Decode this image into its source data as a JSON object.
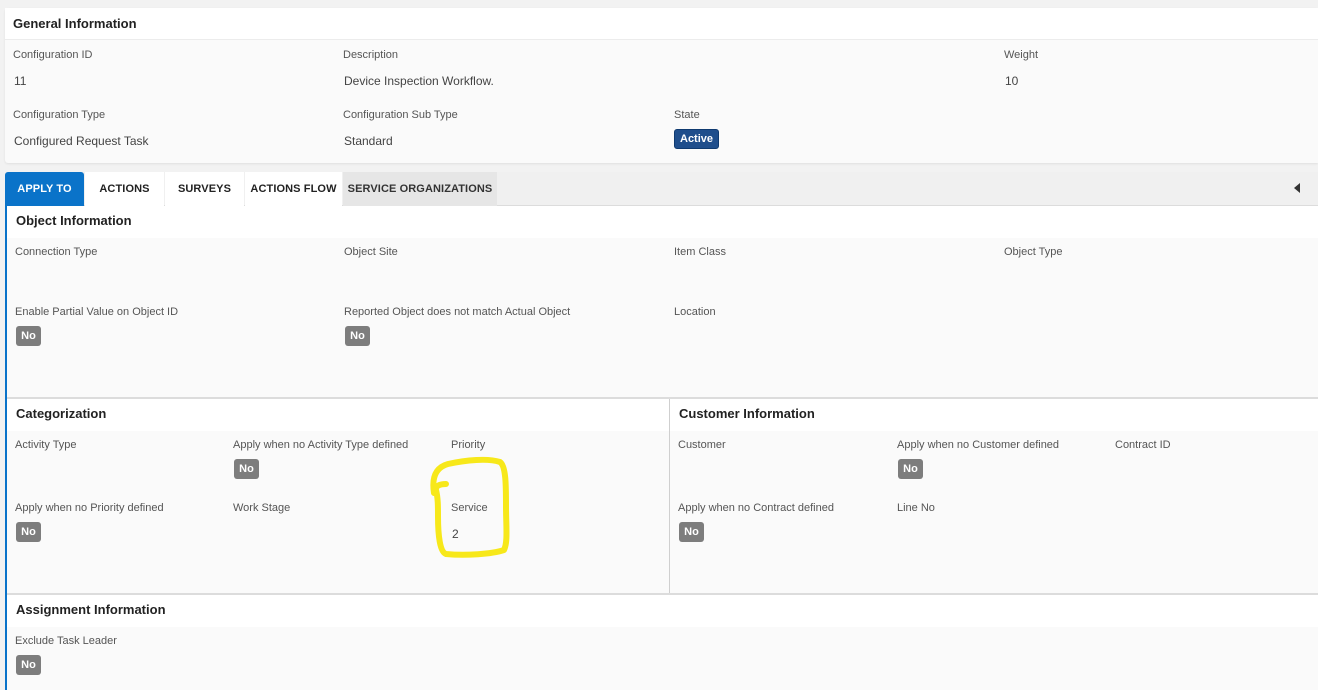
{
  "general": {
    "title": "General Information",
    "config_id_label": "Configuration ID",
    "config_id_value": "11",
    "description_label": "Description",
    "description_value": "Device Inspection Workflow.",
    "weight_label": "Weight",
    "weight_value": "10",
    "config_type_label": "Configuration Type",
    "config_type_value": "Configured Request Task",
    "config_subtype_label": "Configuration Sub Type",
    "config_subtype_value": "Standard",
    "state_label": "State",
    "state_value": "Active"
  },
  "tabs": [
    "APPLY TO",
    "ACTIONS",
    "SURVEYS",
    "ACTIONS FLOW",
    "SERVICE ORGANIZATIONS"
  ],
  "object_info": {
    "title": "Object Information",
    "connection_type_label": "Connection Type",
    "object_site_label": "Object Site",
    "item_class_label": "Item Class",
    "object_type_label": "Object Type",
    "enable_partial_label": "Enable Partial Value on Object ID",
    "enable_partial_value": "No",
    "reported_object_label": "Reported Object does not match Actual Object",
    "reported_object_value": "No",
    "location_label": "Location"
  },
  "categorization": {
    "title": "Categorization",
    "activity_type_label": "Activity Type",
    "apply_no_activity_label": "Apply when no Activity Type defined",
    "apply_no_activity_value": "No",
    "priority_label": "Priority",
    "apply_no_priority_label": "Apply when no Priority defined",
    "apply_no_priority_value": "No",
    "work_stage_label": "Work Stage",
    "service_label": "Service",
    "service_value": "2"
  },
  "customer_info": {
    "title": "Customer Information",
    "customer_label": "Customer",
    "apply_no_customer_label": "Apply when no Customer defined",
    "apply_no_customer_value": "No",
    "contract_id_label": "Contract ID",
    "apply_no_contract_label": "Apply when no Contract defined",
    "apply_no_contract_value": "No",
    "line_no_label": "Line No"
  },
  "assignment_info": {
    "title": "Assignment Information",
    "exclude_task_leader_label": "Exclude Task Leader",
    "exclude_task_leader_value": "No"
  },
  "colors": {
    "tab_active": "#0a73c9",
    "badge_active": "#1f4e8c",
    "badge_no": "#7d7d7d",
    "highlight": "#f7e81a"
  }
}
